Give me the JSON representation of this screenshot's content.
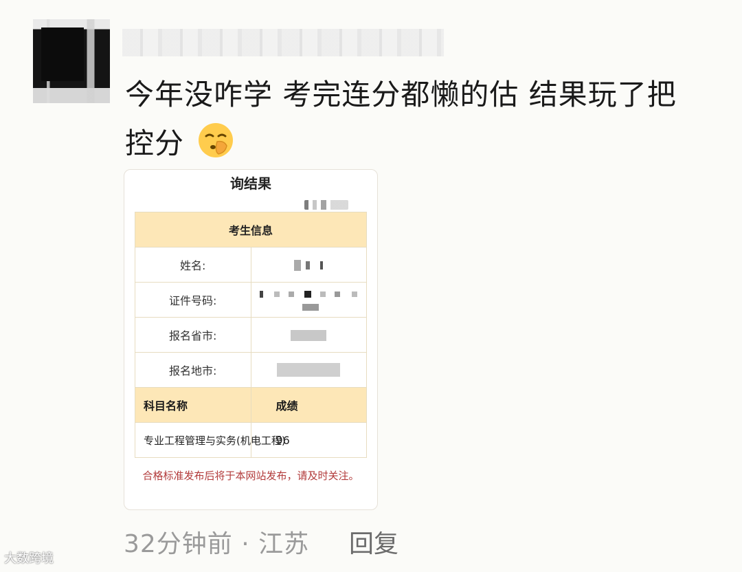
{
  "post": {
    "text_line1": "今年没咋学 考完连分都懒的估 结果玩了把",
    "text_line2": "控分",
    "emoji": "shushing-face-emoji"
  },
  "card": {
    "title": "询结果",
    "section_header": "考生信息",
    "fields": [
      {
        "label": "姓名:",
        "value": ""
      },
      {
        "label": "证件号码:",
        "value": ""
      },
      {
        "label": "报名省市:",
        "value": ""
      },
      {
        "label": "报名地市:",
        "value": ""
      }
    ],
    "subject_header": "科目名称",
    "score_header": "成绩",
    "result": {
      "subject": "专业工程管理与实务(机电工程)",
      "score": "96"
    },
    "notice": "合格标准发布后将于本网站发布，请及时关注。"
  },
  "footer": {
    "time": "32分钟前",
    "dot": "·",
    "location": "江苏",
    "reply": "回复"
  },
  "watermark": "大数跨境"
}
